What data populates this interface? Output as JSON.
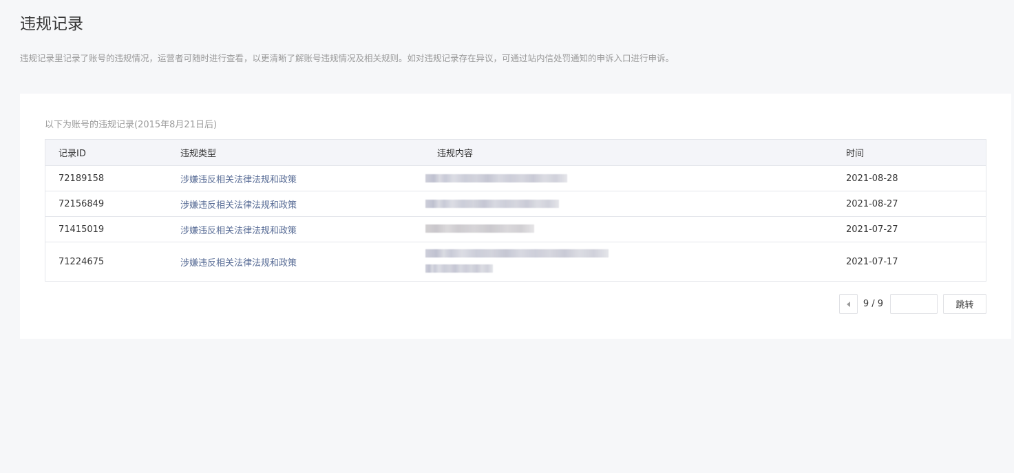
{
  "page": {
    "title": "违规记录",
    "description": "违规记录里记录了账号的违规情况，运营者可随时进行查看，以更清晰了解账号违规情况及相关规则。如对违规记录存在异议，可通过站内信处罚通知的申诉入口进行申诉。"
  },
  "records": {
    "caption": "以下为账号的违规记录(2015年8月21日后)",
    "columns": [
      "记录ID",
      "违规类型",
      "违规内容",
      "时间"
    ],
    "rows": [
      {
        "id": "72189158",
        "type": "涉嫌违反相关法律法规和政策",
        "date": "2021-08-28"
      },
      {
        "id": "72156849",
        "type": "涉嫌违反相关法律法规和政策",
        "date": "2021-08-27"
      },
      {
        "id": "71415019",
        "type": "涉嫌违反相关法律法规和政策",
        "date": "2021-07-27"
      },
      {
        "id": "71224675",
        "type": "涉嫌违反相关法律法规和政策",
        "date": "2021-07-17"
      }
    ]
  },
  "pagination": {
    "page_count": "9 / 9",
    "input_value": "",
    "jump_label": "跳转"
  },
  "icons": {
    "prev": "caret-left-icon"
  }
}
